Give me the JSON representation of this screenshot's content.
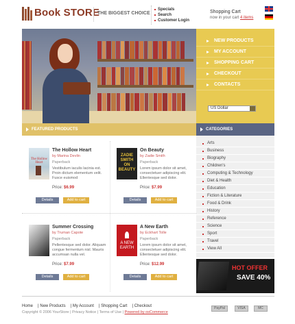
{
  "header": {
    "logo_text": "Book STORE",
    "tagline": "THE BIGGEST CHOICE",
    "links": [
      "Specials",
      "Search",
      "Customer Login"
    ],
    "cart_title": "Shopping Cart",
    "cart_sub_prefix": "now in your cart",
    "cart_items": "4 items"
  },
  "right_menu": {
    "items": [
      "NEW PRODUCTS",
      "MY ACCOUNT",
      "SHOPPING CART",
      "CHECKOUT",
      "CONTACTS"
    ],
    "currency": "US Dollar"
  },
  "featured": {
    "title": "FEATURED PRODUCTS",
    "details_label": "Details",
    "add_label": "Add to cart",
    "products": [
      {
        "title": "The Hollow Heart",
        "author": "by Marina Devlin",
        "format": "Paperback",
        "desc": "Vestibulum iaculis lacinia est. Proin dictum elementum velit. Fusce euismod",
        "price_label": "Price:",
        "price": "$6.99",
        "cover_text": "The Hollow Heart"
      },
      {
        "title": "On Beauty",
        "author": "by Zadie Smith",
        "format": "Paperback",
        "desc": "Lorem ipsum dolor sit amet, consectetuer adipiscing elit. Ellentesque sed dolor.",
        "price_label": "Price:",
        "price": "$7.99",
        "cover_text": "ZADIE SMITH ON BEAUTY"
      },
      {
        "title": "Summer Crossing",
        "author": "by Truman Capote",
        "format": "Paperback",
        "desc": "Pellentesque sed dolor. Aliquam congue fermentum nisl. Mauris accumsan nulla vel.",
        "price_label": "Price:",
        "price": "$7.99",
        "cover_text": ""
      },
      {
        "title": "A New Earth",
        "author": "by Eckhart Tolle",
        "format": "Paperback",
        "desc": "Lorem ipsum dolor sit amet, consectetuer adipiscing elit. Ellentesque sed dolor.",
        "price_label": "Price:",
        "price": "$12.99",
        "cover_text": "A NEW EARTH"
      }
    ]
  },
  "categories": {
    "title": "CATEGORIES",
    "items": [
      "Arts",
      "Business",
      "Biography",
      "Children's",
      "Computing & Technology",
      "Diet & Health",
      "Education",
      "Fiction & Literature",
      "Food & Drink",
      "History",
      "Reference",
      "Science",
      "Sport",
      "Travel",
      "View All"
    ]
  },
  "hot_offer": {
    "line1": "HOT OFFER",
    "line2": "SAVE 40%"
  },
  "footer": {
    "links": [
      "Home",
      "New Products",
      "My Account",
      "Shopping Cart",
      "Checkout"
    ],
    "copyright": "Copyright © 2006 YourStore",
    "privacy": "Privacy Notice",
    "terms": "Terms of Use",
    "powered": "Powered by osCommerce",
    "payments": [
      "PayPal",
      "VISA",
      "MC"
    ]
  },
  "colors": {
    "brand": "#8c3a25",
    "accent": "#e8ca52",
    "nav_dark": "#5a6583",
    "price": "#cc3333"
  }
}
